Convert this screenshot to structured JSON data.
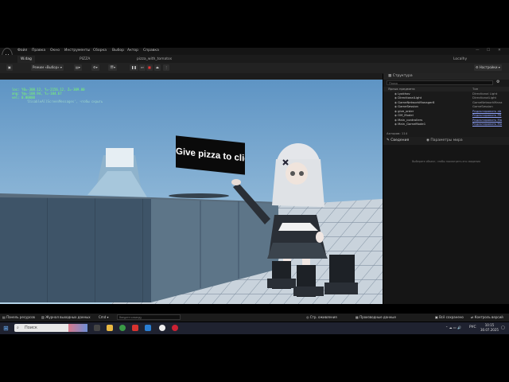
{
  "menu": [
    "Файл",
    "Правка",
    "Окно",
    "Инструменты",
    "Сборка",
    "Выбор",
    "Актор",
    "Справка"
  ],
  "tabs": [
    {
      "label": "W.dag",
      "active": true
    },
    {
      "label": "PIZZA",
      "active": false
    },
    {
      "label": "pizza_with_tomatos",
      "active": false
    }
  ],
  "toolbar": {
    "mode_label": "Режим «Выбор»",
    "right_label": "Localhy",
    "settings_label": "Настройки"
  },
  "viewport": {
    "debug_lines": [
      "loc: Y0=-308.12, Y=-2156.12, Z=-309.00",
      "ang: Y@=-108.94, Y=-104.67",
      "vel: 0.00000"
    ],
    "debug_hint": "'DisableAllScreenMessages', чтобы скрыть",
    "sign_text": "Give pizza to client"
  },
  "outliner": {
    "title": "Структура",
    "search_placeholder": "Поиск",
    "col_label": "Ярлык предмета",
    "col_type": "Тип",
    "rows": [
      {
        "label": "Lyakhov",
        "type": "Directional Light",
        "link": false
      },
      {
        "label": "DirectionalLight",
        "type": "DirectionalLight",
        "link": false
      },
      {
        "label": "GameNetworkManager8",
        "type": "GameNetworkMana",
        "link": false
      },
      {
        "label": "GameSession",
        "type": "GameSession",
        "link": false
      },
      {
        "label": "give_order",
        "type": "Редактировать ab",
        "link": true
      },
      {
        "label": "OM_Model",
        "type": "Редактировать PR",
        "link": true
      },
      {
        "label": "Main_controllers",
        "type": "Редактировать Ма",
        "link": true
      },
      {
        "label": "Main_GameMode1",
        "type": "Редактировать Ма",
        "link": true
      }
    ],
    "footer": "Акторов: 114"
  },
  "details": {
    "tab1": "Сведения",
    "tab2": "Параметры мира",
    "empty_hint": "Выберите объект, чтобы посмотреть его сведения"
  },
  "statusbar": {
    "left1": "Панель ресурсов",
    "left2": "Журнал выходных данных",
    "cmd": "Cmd",
    "console_placeholder": "Введите команду",
    "right1": "Стр. оживления",
    "right2": "Производные данные",
    "right3": "Всё сохранено",
    "right4": "Контроль версий"
  },
  "taskbar": {
    "search_label": "Поиск",
    "lang": "РУС",
    "time": "10:15",
    "date": "30.07.2025"
  }
}
